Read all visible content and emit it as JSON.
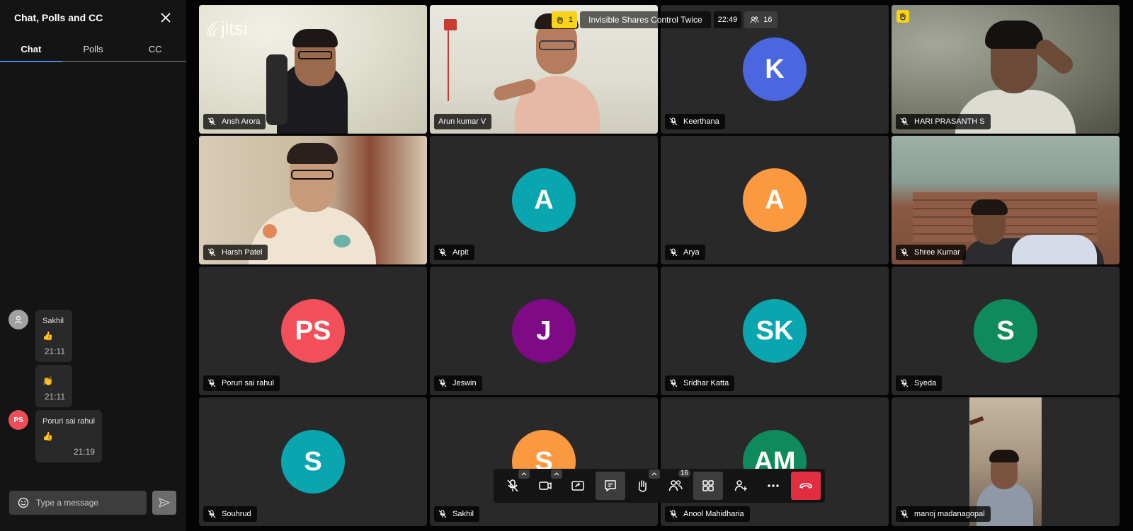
{
  "sidebar": {
    "title": "Chat, Polls and CC",
    "tabs": [
      "Chat",
      "Polls",
      "CC"
    ],
    "active_tab": "Chat",
    "messages": [
      {
        "sender": "Sakhil",
        "avatar": "",
        "text": "👍",
        "time": "21:11"
      },
      {
        "sender": "",
        "avatar": "",
        "text": "👏",
        "time": "21:11"
      },
      {
        "sender": "Poruri sai rahul",
        "avatar": "PS",
        "text": "👍",
        "time": "21:19"
      }
    ],
    "input_placeholder": "Type a message"
  },
  "topbar": {
    "raised_hands": "1",
    "meeting_name": "Invisible Shares Control Twice",
    "time": "22:49",
    "participants": "16"
  },
  "logo": "jitsi",
  "tiles": [
    {
      "name": "Ansh Arora",
      "initials": "",
      "color": ""
    },
    {
      "name": "Arun kumar V",
      "initials": "",
      "color": ""
    },
    {
      "name": "Keerthana",
      "initials": "K",
      "color": "#4a67e0"
    },
    {
      "name": "HARI PRASANTH S",
      "initials": "",
      "color": ""
    },
    {
      "name": "Harsh Patel",
      "initials": "",
      "color": ""
    },
    {
      "name": "Arpit",
      "initials": "A",
      "color": "#0aa6b0"
    },
    {
      "name": "Arya",
      "initials": "A",
      "color": "#fb9940"
    },
    {
      "name": "Shree Kumar",
      "initials": "",
      "color": ""
    },
    {
      "name": "Poruri sai rahul",
      "initials": "PS",
      "color": "#f24f5a"
    },
    {
      "name": "Jeswin",
      "initials": "J",
      "color": "#7e0a86"
    },
    {
      "name": "Sridhar Katta",
      "initials": "SK",
      "color": "#0aa6b0"
    },
    {
      "name": "Syeda",
      "initials": "S",
      "color": "#0e8a5c"
    },
    {
      "name": "Souhrud",
      "initials": "S",
      "color": "#0aa6b0"
    },
    {
      "name": "Sakhil",
      "initials": "S",
      "color": "#fb9940"
    },
    {
      "name": "Anool Mahidharia",
      "initials": "AM",
      "color": "#0e8a5c"
    },
    {
      "name": "manoj madanagopal",
      "initials": "",
      "color": ""
    }
  ],
  "toolbar": {
    "participants_count": "16"
  },
  "colors": {
    "accent": "#246fe5",
    "raise_hand": "#f8d31a",
    "hangup": "#e12d40"
  }
}
